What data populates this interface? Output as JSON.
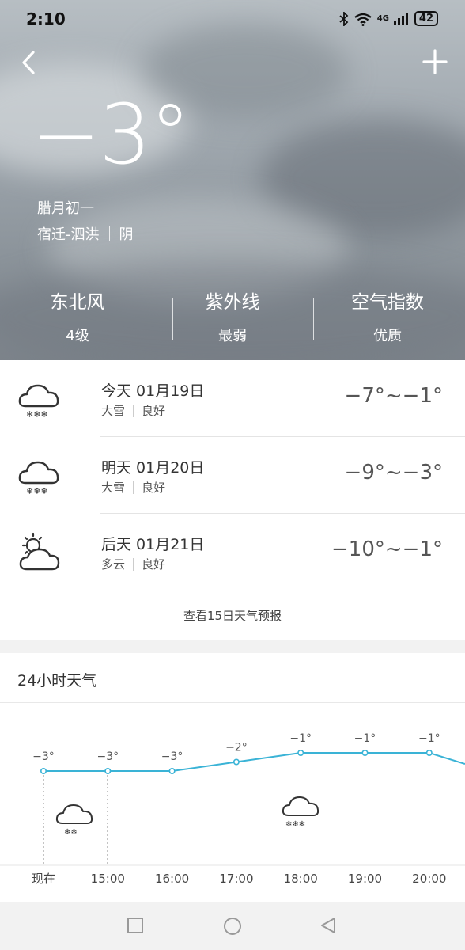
{
  "status": {
    "time": "2:10",
    "network": "4G",
    "battery": "42"
  },
  "current": {
    "temperature": "−3°",
    "lunar_date": "腊月初一",
    "location": "宿迁-泗洪",
    "condition": "阴"
  },
  "metrics": [
    {
      "title": "东北风",
      "value": "4级"
    },
    {
      "title": "紫外线",
      "value": "最弱"
    },
    {
      "title": "空气指数",
      "value": "优质"
    }
  ],
  "forecast": [
    {
      "date": "今天 01月19日",
      "weather": "大雪",
      "air": "良好",
      "range": "−7°~−1°",
      "icon": "snow-cloud-icon"
    },
    {
      "date": "明天 01月20日",
      "weather": "大雪",
      "air": "良好",
      "range": "−9°~−3°",
      "icon": "snow-cloud-icon"
    },
    {
      "date": "后天 01月21日",
      "weather": "多云",
      "air": "良好",
      "range": "−10°~−1°",
      "icon": "partly-cloudy-icon"
    }
  ],
  "more_label": "查看15日天气预报",
  "hourly": {
    "title": "24小时天气",
    "times": [
      "现在",
      "15:00",
      "16:00",
      "17:00",
      "18:00",
      "19:00",
      "20:00"
    ],
    "temps": [
      -3,
      -3,
      -3,
      -2,
      -1,
      -1,
      -1
    ],
    "temp_labels": [
      "−3°",
      "−3°",
      "−3°",
      "−2°",
      "−1°",
      "−1°",
      "−1°"
    ],
    "accent": "#3ab3d6"
  }
}
